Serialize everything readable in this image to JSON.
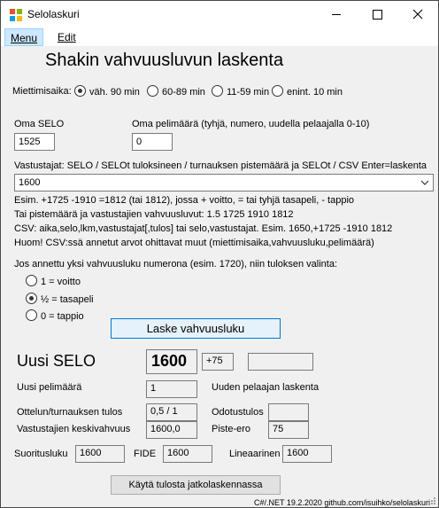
{
  "window": {
    "title": "Selolaskuri"
  },
  "menu": {
    "items": [
      "Menu",
      "Edit"
    ]
  },
  "heading": "Shakin vahvuusluvun laskenta",
  "time": {
    "label": "Miettimisaika:",
    "options": [
      "väh. 90 min",
      "60-89 min",
      "11-59 min",
      "enint. 10 min"
    ],
    "selected": 0
  },
  "own_selo": {
    "label": "Oma SELO",
    "value": "1525"
  },
  "own_games": {
    "label": "Oma pelimäärä (tyhjä, numero, uudella pelaajalla 0-10)",
    "value": "0"
  },
  "opponents": {
    "label": "Vastustajat: SELO / SELOt tuloksineen / turnauksen pistemäärä ja SELOt / CSV  Enter=laskenta",
    "value": "1600"
  },
  "help_lines": [
    "Esim. +1725 -1910 =1812 (tai 1812), jossa + voitto, = tai tyhjä tasapeli, - tappio",
    "Tai pistemäärä ja vastustajien vahvuusluvut: 1.5 1725 1910 1812",
    "CSV: aika,selo,lkm,vastustajat[,tulos] tai selo,vastustajat. Esim. 1650,+1725 -1910 1812",
    "Huom! CSV:ssä annetut arvot ohittavat muut (miettimisaika,vahvuusluku,pelimäärä)"
  ],
  "result_choice": {
    "label": "Jos annettu yksi vahvuusluku numerona (esim. 1720), niin tuloksen valinta:",
    "options": [
      "1 = voitto",
      "½ = tasapeli",
      "0 = tappio"
    ],
    "selected": 1
  },
  "calc_button": "Laske vahvuusluku",
  "results": {
    "new_selo_label": "Uusi SELO",
    "new_selo": "1600",
    "change": "+75",
    "change_extra": "",
    "new_games_label": "Uusi pelimäärä",
    "new_games": "1",
    "new_player_label": "Uuden pelaajan laskenta",
    "score_label": "Ottelun/turnauksen tulos",
    "score": "0,5 / 1",
    "expected_label": "Odotustulos",
    "expected": "",
    "avg_label": "Vastustajien keskivahvuus",
    "avg": "1600,0",
    "diff_label": "Piste-ero",
    "diff": "75",
    "perf_label": "Suoritusluku",
    "perf": "1600",
    "fide_label": "FIDE",
    "fide": "1600",
    "linear_label": "Lineaarinen",
    "linear": "1600"
  },
  "continue_button": "Käytä tulosta jatkolaskennassa",
  "footer": "C#/.NET 19.2.2020 github.com/isuihko/selolaskuri",
  "colors": {
    "accent": "#0078d7",
    "title_icon": [
      "#f25022",
      "#7fba00",
      "#00a4ef",
      "#ffb900"
    ]
  }
}
